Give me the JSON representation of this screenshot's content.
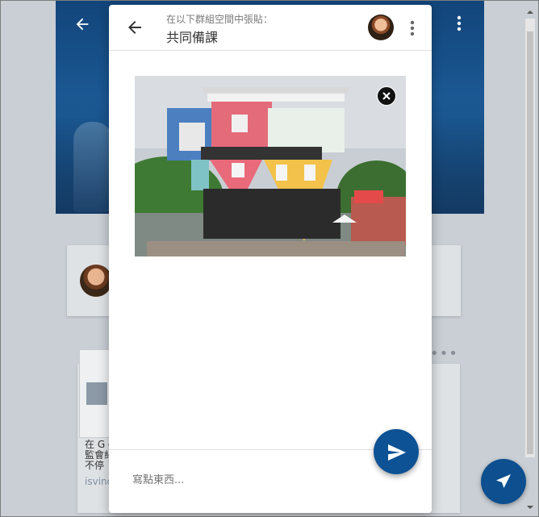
{
  "dialog": {
    "subtitle": "在以下群組空間中張貼：",
    "title": "共同備課",
    "compose_placeholder": "寫點東西..."
  },
  "background": {
    "snippet_lines": [
      "在 G o",
      "監會糾",
      "不停"
    ],
    "snippet_source": "isvinc"
  },
  "icons": {
    "back": "arrow-left-icon",
    "more": "more-vert-icon",
    "remove": "close-icon",
    "send": "send-icon",
    "fab": "navigation-icon"
  },
  "colors": {
    "accent": "#0d5295",
    "hero": "#1b5893"
  }
}
